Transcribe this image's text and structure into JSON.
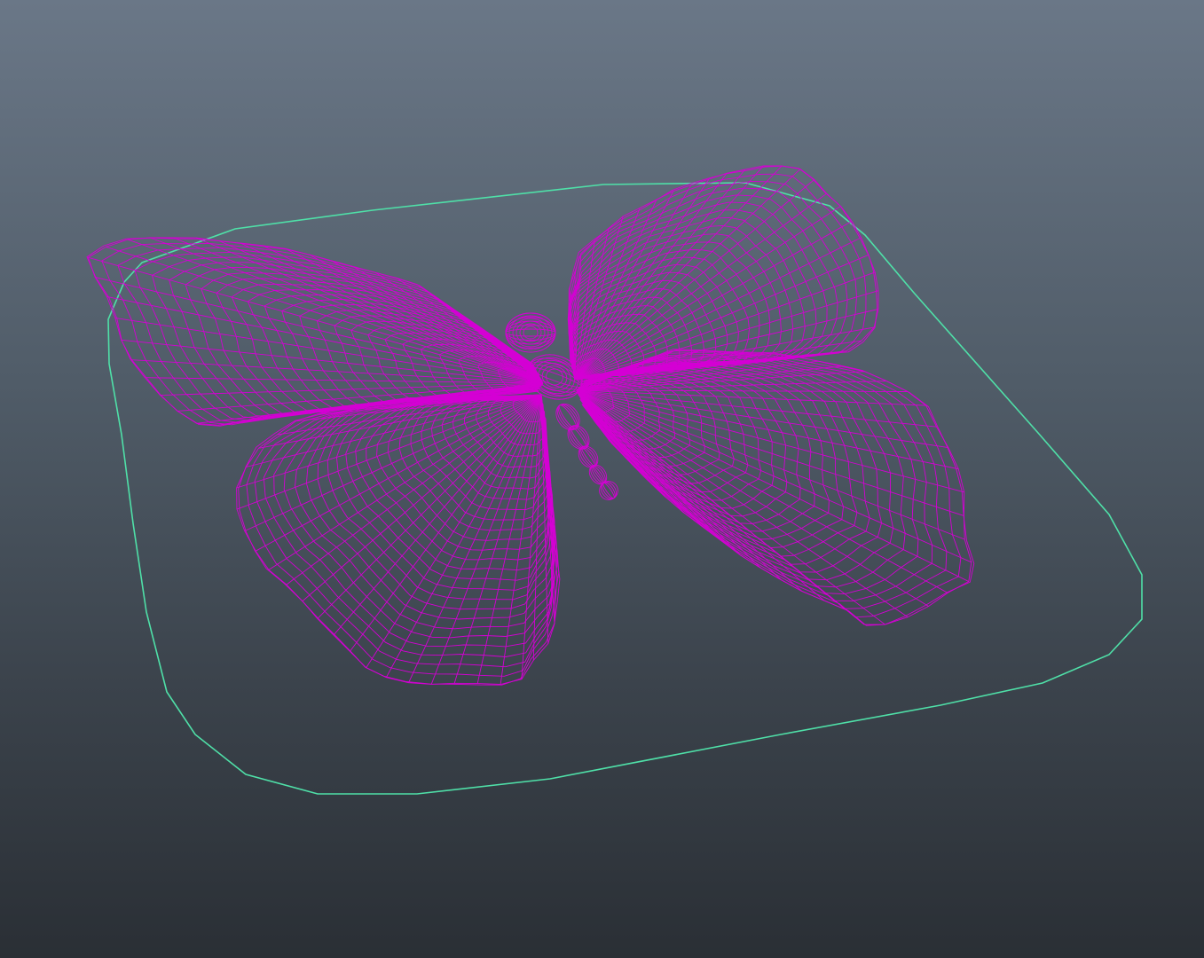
{
  "viewport": {
    "background_top": "#6a7787",
    "background_bottom": "#2a2f35"
  },
  "scene": {
    "wireframe_color": "#d400d4",
    "control_curve_color": "#4fe0a8",
    "objects": [
      "butterfly-wireframe",
      "control-curve"
    ]
  }
}
